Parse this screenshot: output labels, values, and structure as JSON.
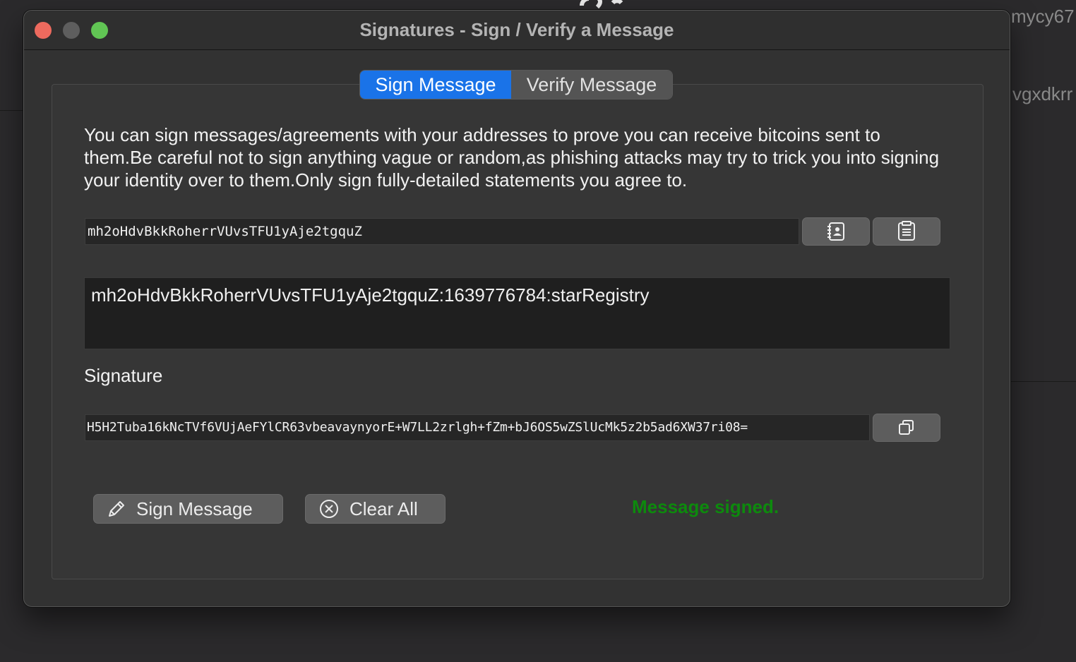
{
  "background": {
    "text_1": "mycy67",
    "text_2": "vgxdkrr"
  },
  "window": {
    "title": "Signatures - Sign / Verify a Message"
  },
  "tabs": [
    {
      "label": "Sign Message",
      "active": true
    },
    {
      "label": "Verify Message",
      "active": false
    }
  ],
  "description": "You can sign messages/agreements with your addresses to prove you can receive bitcoins sent to them.Be careful not to sign anything vague or random,as phishing attacks may try to trick you into signing your identity over to them.Only sign fully-detailed statements you agree to.",
  "address": {
    "value": "mh2oHdvBkkRoherrVUvsTFU1yAje2tgquZ",
    "address_book_icon": "address-book-icon",
    "paste_icon": "paste-icon"
  },
  "message": {
    "value": "mh2oHdvBkkRoherrVUvsTFU1yAje2tgquZ:1639776784:starRegistry"
  },
  "signature": {
    "label": "Signature",
    "value": "H5H2Tuba16kNcTVf6VUjAeFYlCR63vbeavaynyorE+W7LL2zrlgh+fZm+bJ6OS5wZSlUcMk5z2b5ad6XW37ri08=",
    "copy_icon": "copy-icon"
  },
  "actions": {
    "sign_label": "Sign Message",
    "clear_label": "Clear All"
  },
  "status": {
    "text": "Message signed.",
    "color": "#0d8a0d"
  },
  "colors": {
    "accent": "#1a73e8",
    "close": "#ed6a5e",
    "maximize": "#61c554"
  }
}
